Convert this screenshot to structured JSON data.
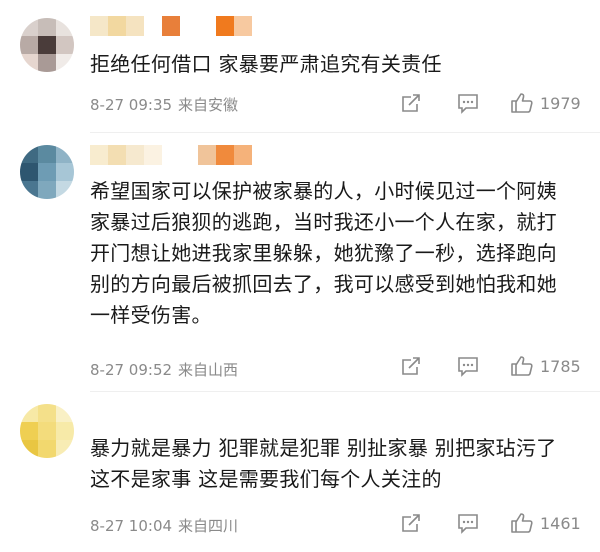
{
  "comments": [
    {
      "avatar_colors": [
        "#d9d0cc",
        "#c7bdb8",
        "#e8e2de",
        "#b8aaa5",
        "#4a3c3a",
        "#d2c6c1",
        "#e6d6cf",
        "#a99a96",
        "#f0ebe8"
      ],
      "username_colors": [
        "#f5e7c8",
        "#f2d8a0",
        "#f5e3c0",
        "#ffffff",
        "#e87f3a",
        "#ffffff",
        "#ffffff",
        "#f07a1e",
        "#f7c9a0"
      ],
      "lines": [
        "拒绝任何借口 家暴要严肃追究有关责任"
      ],
      "date": "8-27 09:35",
      "location": "来自安徽",
      "likes": "1979"
    },
    {
      "avatar_colors": [
        "#3f6a82",
        "#5b8aa0",
        "#8fb3c6",
        "#2e5670",
        "#6e9cb4",
        "#a7c6d6",
        "#4a7690",
        "#7fa8bd",
        "#c4d9e3"
      ],
      "username_colors": [
        "#f8eccf",
        "#f3deb2",
        "#f6e9cf",
        "#fbf2e2",
        "#ffffff",
        "#ffffff",
        "#f0c49a",
        "#f08a3c",
        "#f5b27a"
      ],
      "lines": [
        "希望国家可以保护被家暴的人，小时候见过一个阿姨",
        "家暴过后狼狈的逃跑，当时我还小一个人在家，就打",
        "开门想让她进我家里躲躲，她犹豫了一秒，选择跑向",
        "别的方向最后被抓回去了，我可以感受到她怕我和她",
        "一样受伤害。"
      ],
      "date": "8-27 09:52",
      "location": "来自山西",
      "likes": "1785"
    },
    {
      "avatar_colors": [
        "#f7e9a6",
        "#f4e08a",
        "#f9f0c5",
        "#efcf52",
        "#f3dc7c",
        "#f7eaa8",
        "#e9c642",
        "#f2d86e",
        "#f8ecb4"
      ],
      "username_colors": [],
      "lines": [
        "暴力就是暴力 犯罪就是犯罪 别扯家暴 别把家玷污了",
        "这不是家事 这是需要我们每个人关注的"
      ],
      "date": "8-27 10:04",
      "location": "来自四川",
      "likes": "1461"
    }
  ]
}
